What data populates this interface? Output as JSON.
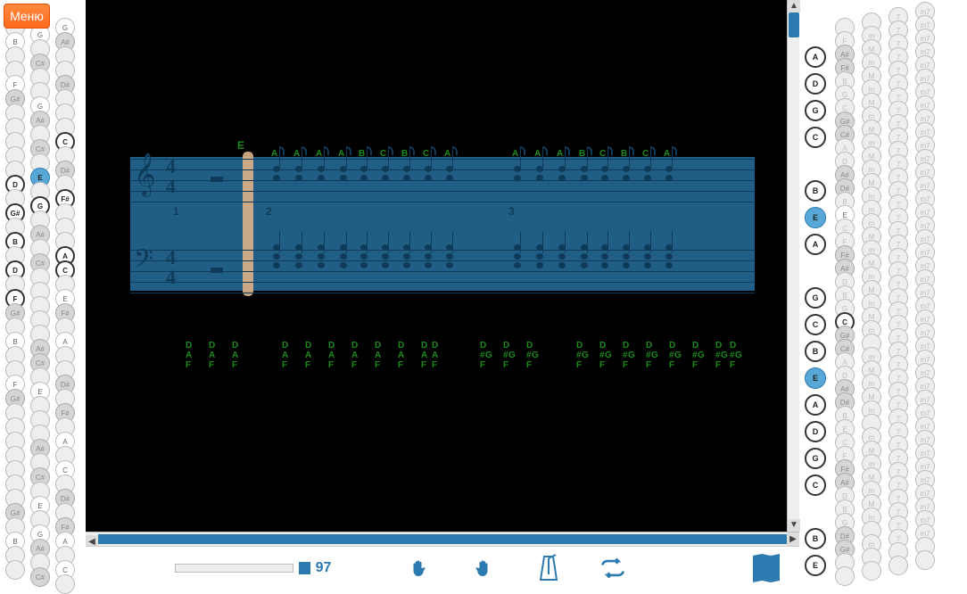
{
  "menu_label": "Меню",
  "tempo": "97",
  "score": {
    "key_label": "E",
    "time_sig_top": "4",
    "time_sig_bottom": "4",
    "bar_numbers": [
      "1",
      "2",
      "3"
    ],
    "top_chord_marks": [
      "A",
      "A",
      "A",
      "A",
      "B",
      "C",
      "B",
      "C",
      "A",
      "A",
      "A",
      "A",
      "B",
      "C",
      "B",
      "C",
      "A"
    ]
  },
  "tab_cols_a": "D\nA\nF",
  "tab_cols_b": "D\n#G\nF",
  "left_kb_rows": [
    [
      "",
      "F",
      "G"
    ],
    [
      "",
      "G",
      "A#"
    ],
    [
      "B",
      "",
      "",
      ""
    ],
    [
      "",
      "C#",
      ""
    ],
    [
      "",
      "",
      "D#"
    ],
    [
      "F",
      "",
      "",
      ""
    ],
    [
      "G#",
      "G",
      ""
    ],
    [
      "",
      "A#",
      ""
    ],
    [
      "",
      "",
      "C"
    ],
    [
      "",
      "C#",
      ""
    ],
    [
      "",
      "",
      "D#"
    ],
    [
      "",
      "E",
      ""
    ],
    [
      "D",
      "",
      "F#"
    ],
    [
      "",
      "G",
      ""
    ],
    [
      "G#",
      "",
      "",
      ""
    ],
    [
      "",
      "A#",
      ""
    ],
    [
      "B",
      "",
      "A"
    ],
    [
      "",
      "C#",
      "C"
    ],
    [
      "D",
      "",
      "",
      ""
    ],
    [
      "",
      "",
      "E"
    ],
    [
      "F",
      "",
      "F#"
    ],
    [
      "G#",
      "",
      "",
      ""
    ],
    [
      "",
      "",
      "A"
    ],
    [
      "B",
      "A#",
      ""
    ],
    [
      "",
      "C#",
      ""
    ],
    [
      "",
      "",
      "D#"
    ],
    [
      "F",
      "E",
      ""
    ],
    [
      "G#",
      "",
      "F#"
    ],
    [
      "",
      "",
      "",
      ""
    ],
    [
      "",
      "",
      "A"
    ],
    [
      "",
      "A#",
      ""
    ],
    [
      "",
      "",
      "C"
    ],
    [
      "",
      "C#",
      ""
    ],
    [
      "",
      "",
      "D#"
    ],
    [
      "",
      "E",
      ""
    ],
    [
      "G#",
      "",
      "F#"
    ],
    [
      "",
      "G",
      "A"
    ],
    [
      "B",
      "A#",
      ""
    ],
    [
      "",
      "",
      "C"
    ],
    [
      "",
      "C#",
      ""
    ]
  ],
  "left_kb_highlights": {
    "active": [
      "D",
      "F",
      "G#",
      "B",
      "D",
      "F"
    ],
    "col2": [
      "E",
      "G",
      "E"
    ],
    "col3": [
      "C",
      "F#",
      "A",
      "C",
      "E"
    ]
  },
  "right_kb_rows": [
    [
      "",
      "",
      "",
      "",
      "7",
      "m7"
    ],
    [
      "",
      "",
      "F",
      "m",
      "7",
      "m7"
    ],
    [
      "A",
      "",
      "A#",
      "M",
      "7",
      "m7"
    ],
    [
      "",
      "",
      "F#",
      "m",
      "7",
      "m7"
    ],
    [
      "D",
      "",
      "B",
      "M",
      "7",
      "m7"
    ],
    [
      "",
      "",
      "G",
      "m",
      "7",
      "m7"
    ],
    [
      "G",
      "",
      "C",
      "M",
      "7",
      "m7"
    ],
    [
      "",
      "",
      "G#",
      "m",
      "7",
      "m7"
    ],
    [
      "C",
      "",
      "C#",
      "M",
      "7",
      "m7"
    ],
    [
      "",
      "",
      "A",
      "m",
      "7",
      "m7"
    ],
    [
      "",
      "",
      "D",
      "M",
      "7",
      "m7"
    ],
    [
      "",
      "",
      "A#",
      "m",
      "7",
      "m7"
    ],
    [
      "B",
      "",
      "D#",
      "M",
      "7",
      "m7"
    ],
    [
      "",
      "",
      "B",
      "m",
      "7",
      "m7"
    ],
    [
      "E",
      "",
      "E",
      "m",
      "7",
      "m7"
    ],
    [
      "",
      "",
      "C",
      "m",
      "7",
      "m7"
    ],
    [
      "A",
      "",
      "F",
      "M",
      "7",
      "m7"
    ],
    [
      "",
      "",
      "F#",
      "m",
      "7",
      "m7"
    ],
    [
      "",
      "",
      "A#",
      "M",
      "7",
      "m7"
    ],
    [
      "",
      "",
      "D",
      "m",
      "7",
      "m7"
    ],
    [
      "G",
      "",
      "B",
      "M",
      "7",
      "m7"
    ],
    [
      "",
      "",
      "G",
      "m",
      "7",
      "m7"
    ],
    [
      "C",
      "",
      "C",
      "M",
      "7",
      "m7"
    ],
    [
      "",
      "",
      "G#",
      "m",
      "7",
      "m7"
    ],
    [
      "B",
      "",
      "C#",
      "",
      "7",
      "m7"
    ],
    [
      "",
      "",
      "A",
      "m",
      "7",
      "m7"
    ],
    [
      "E",
      "",
      "D",
      "M",
      "7",
      "m7"
    ],
    [
      "",
      "",
      "A#",
      "m",
      "7",
      "m7"
    ],
    [
      "A",
      "",
      "D#",
      "M",
      "7",
      "m7"
    ],
    [
      "",
      "",
      "B",
      "m",
      "7",
      "m7"
    ],
    [
      "D",
      "",
      "E",
      "",
      "7",
      "m7"
    ],
    [
      "",
      "",
      "C",
      "m",
      "7",
      "m7"
    ],
    [
      "G",
      "",
      "F",
      "M",
      "7",
      "m7"
    ],
    [
      "",
      "",
      "F#",
      "m",
      "7",
      "m7"
    ],
    [
      "C",
      "",
      "A#",
      "M",
      "7",
      "m7"
    ],
    [
      "",
      "",
      "D",
      "m",
      "7",
      "m7"
    ],
    [
      "",
      "",
      "B",
      "M",
      "7",
      "m7"
    ],
    [
      "",
      "",
      "G",
      "m",
      "7",
      "m7"
    ],
    [
      "B",
      "",
      "D#",
      "",
      "7",
      "m7"
    ],
    [
      "",
      "",
      "G#",
      "m",
      "7",
      "m7"
    ],
    [
      "E",
      "",
      "",
      "",
      "",
      ""
    ],
    [
      "",
      "",
      "",
      "",
      "",
      ""
    ]
  ],
  "right_kb_hl_rows": [
    14,
    26
  ],
  "colors": {
    "accent": "#2d7ab0",
    "chord": "#1a8a1a",
    "menu": "#ff6a1f"
  }
}
